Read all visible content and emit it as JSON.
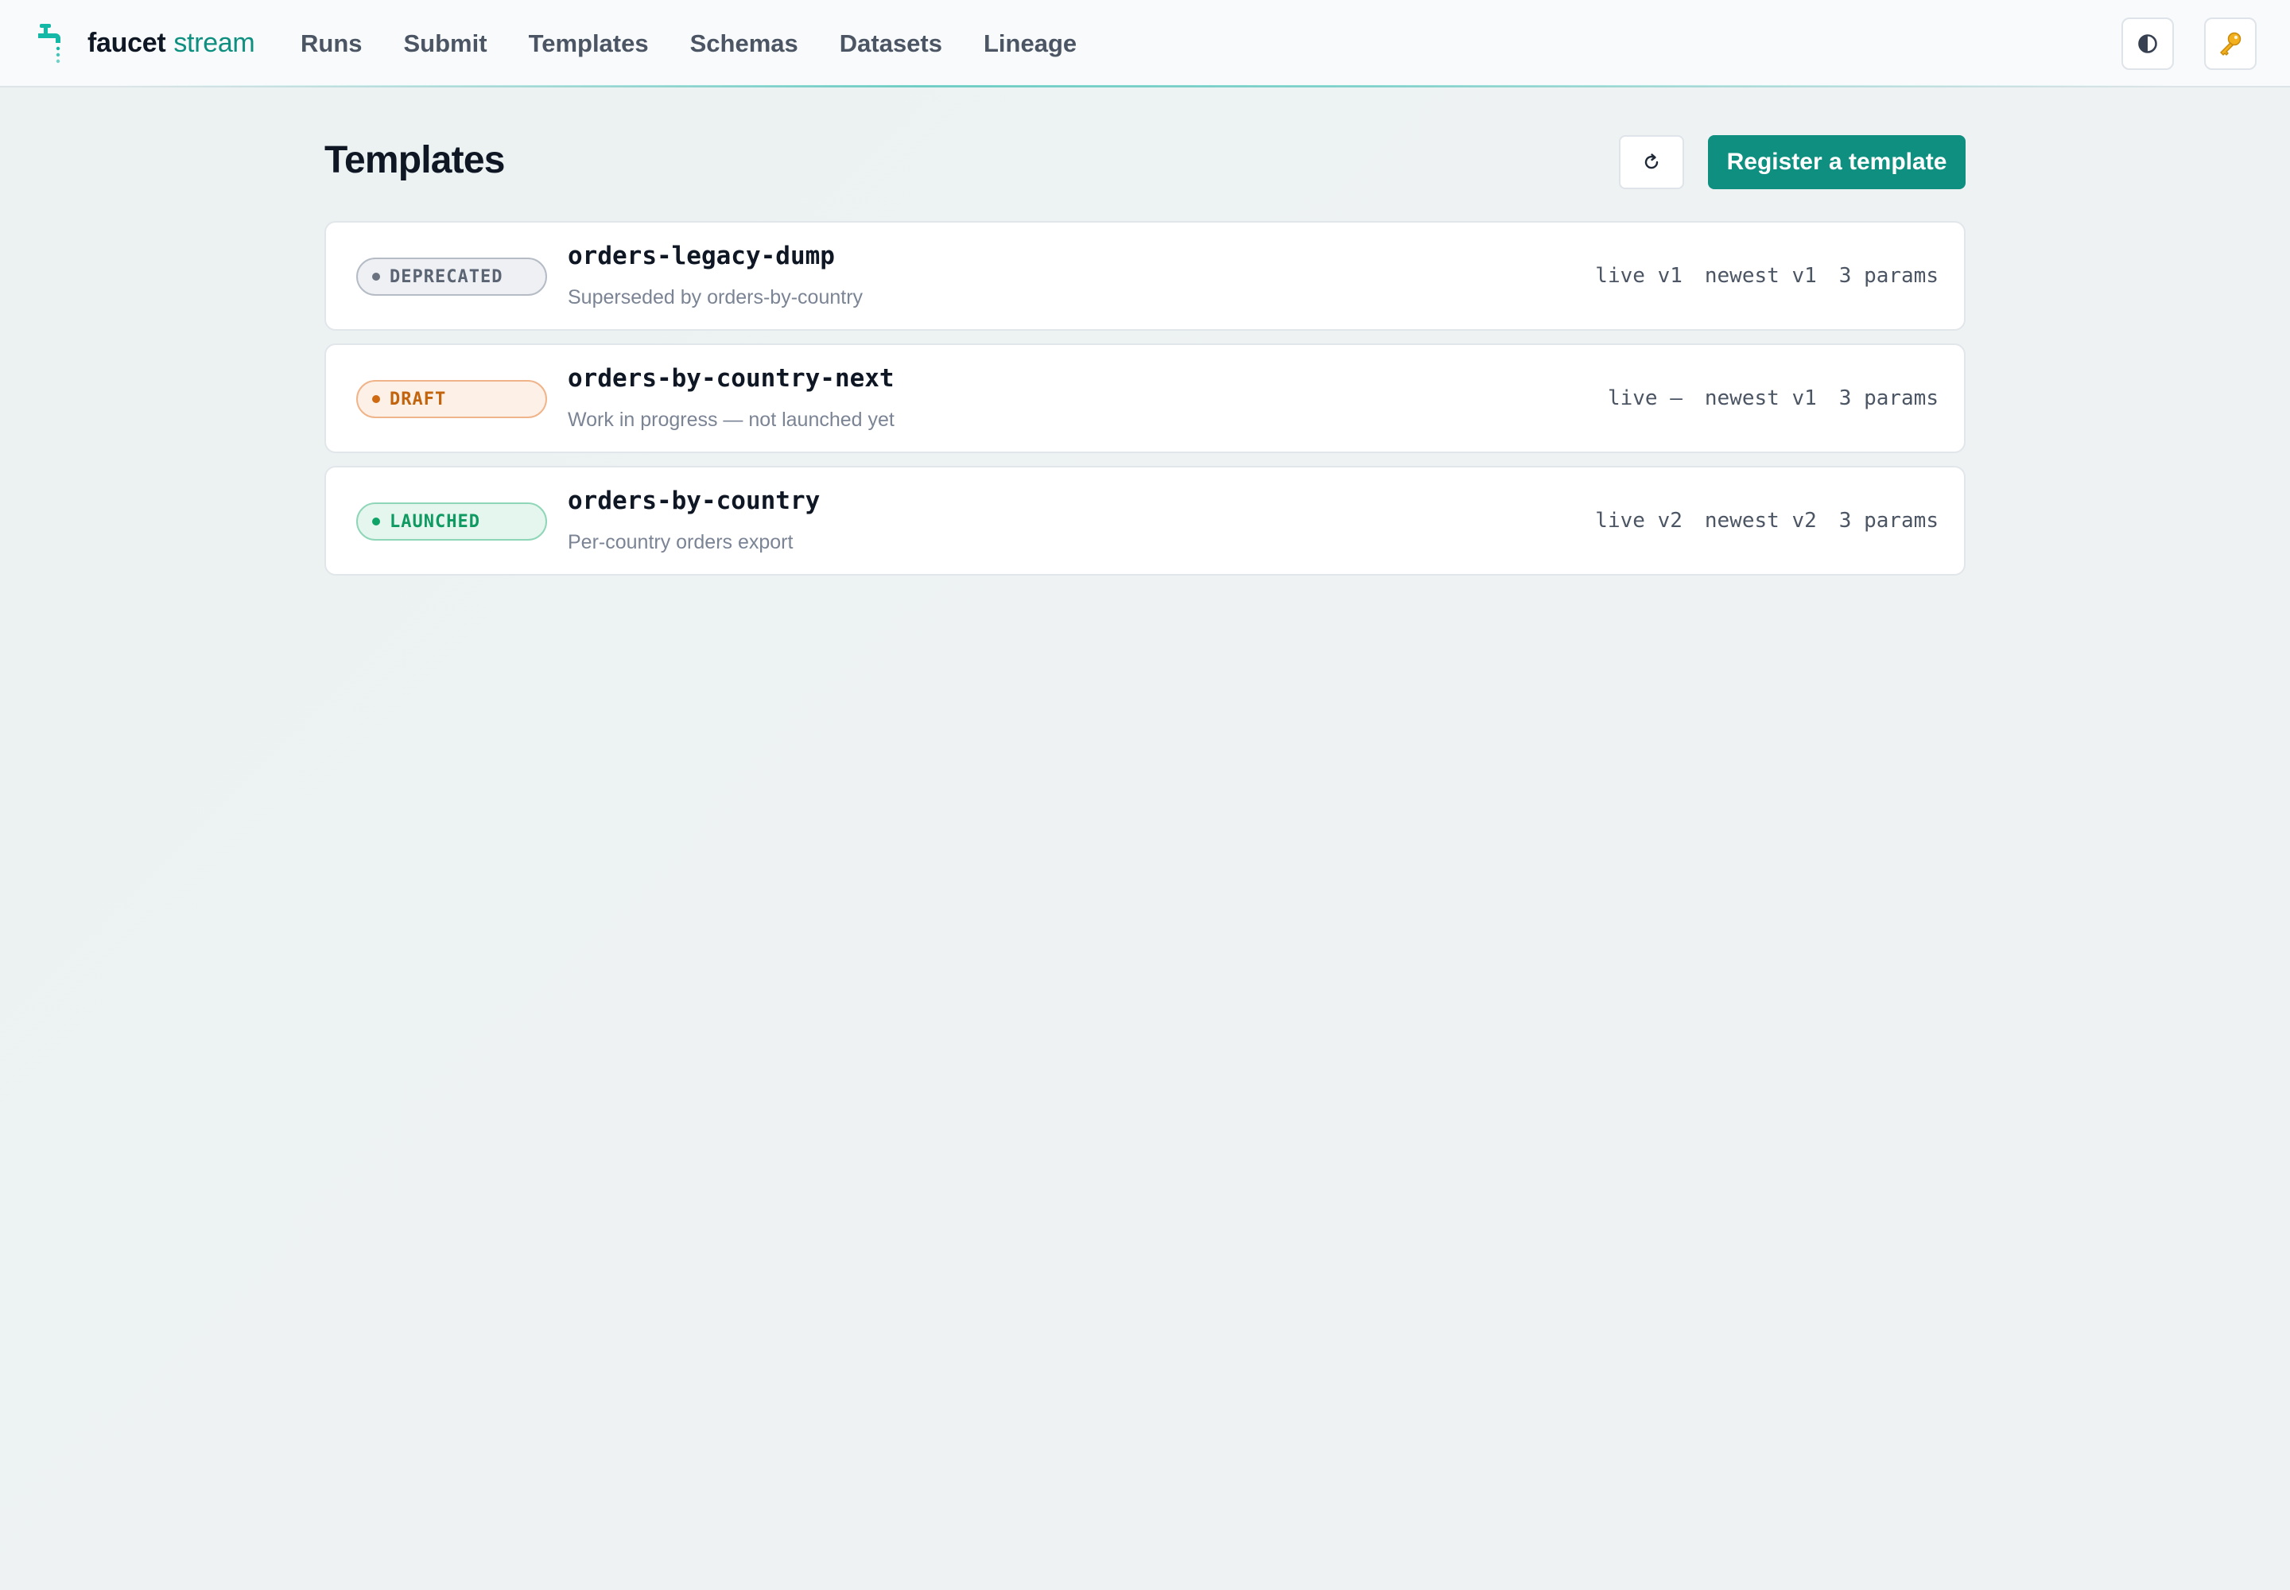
{
  "brand": {
    "name": "faucet",
    "sub": "stream"
  },
  "nav": {
    "items": [
      {
        "label": "Runs"
      },
      {
        "label": "Submit"
      },
      {
        "label": "Templates"
      },
      {
        "label": "Schemas"
      },
      {
        "label": "Datasets"
      },
      {
        "label": "Lineage"
      }
    ]
  },
  "header_actions": {
    "theme_icon": "contrast-icon",
    "key_icon": "key-icon"
  },
  "page": {
    "title": "Templates",
    "refresh_icon": "refresh-icon",
    "register_label": "Register a template"
  },
  "colors": {
    "accent": "#0f8f80",
    "deprecated": "#6b7280",
    "draft": "#d06a12",
    "launched": "#10a367"
  },
  "templates": [
    {
      "status": "DEPRECATED",
      "name": "orders-legacy-dump",
      "description": "Superseded by orders-by-country",
      "live": "live v1",
      "newest": "newest v1",
      "params": "3 params"
    },
    {
      "status": "DRAFT",
      "name": "orders-by-country-next",
      "description": "Work in progress — not launched yet",
      "live": "live —",
      "newest": "newest v1",
      "params": "3 params"
    },
    {
      "status": "LAUNCHED",
      "name": "orders-by-country",
      "description": "Per-country orders export",
      "live": "live v2",
      "newest": "newest v2",
      "params": "3 params"
    }
  ]
}
